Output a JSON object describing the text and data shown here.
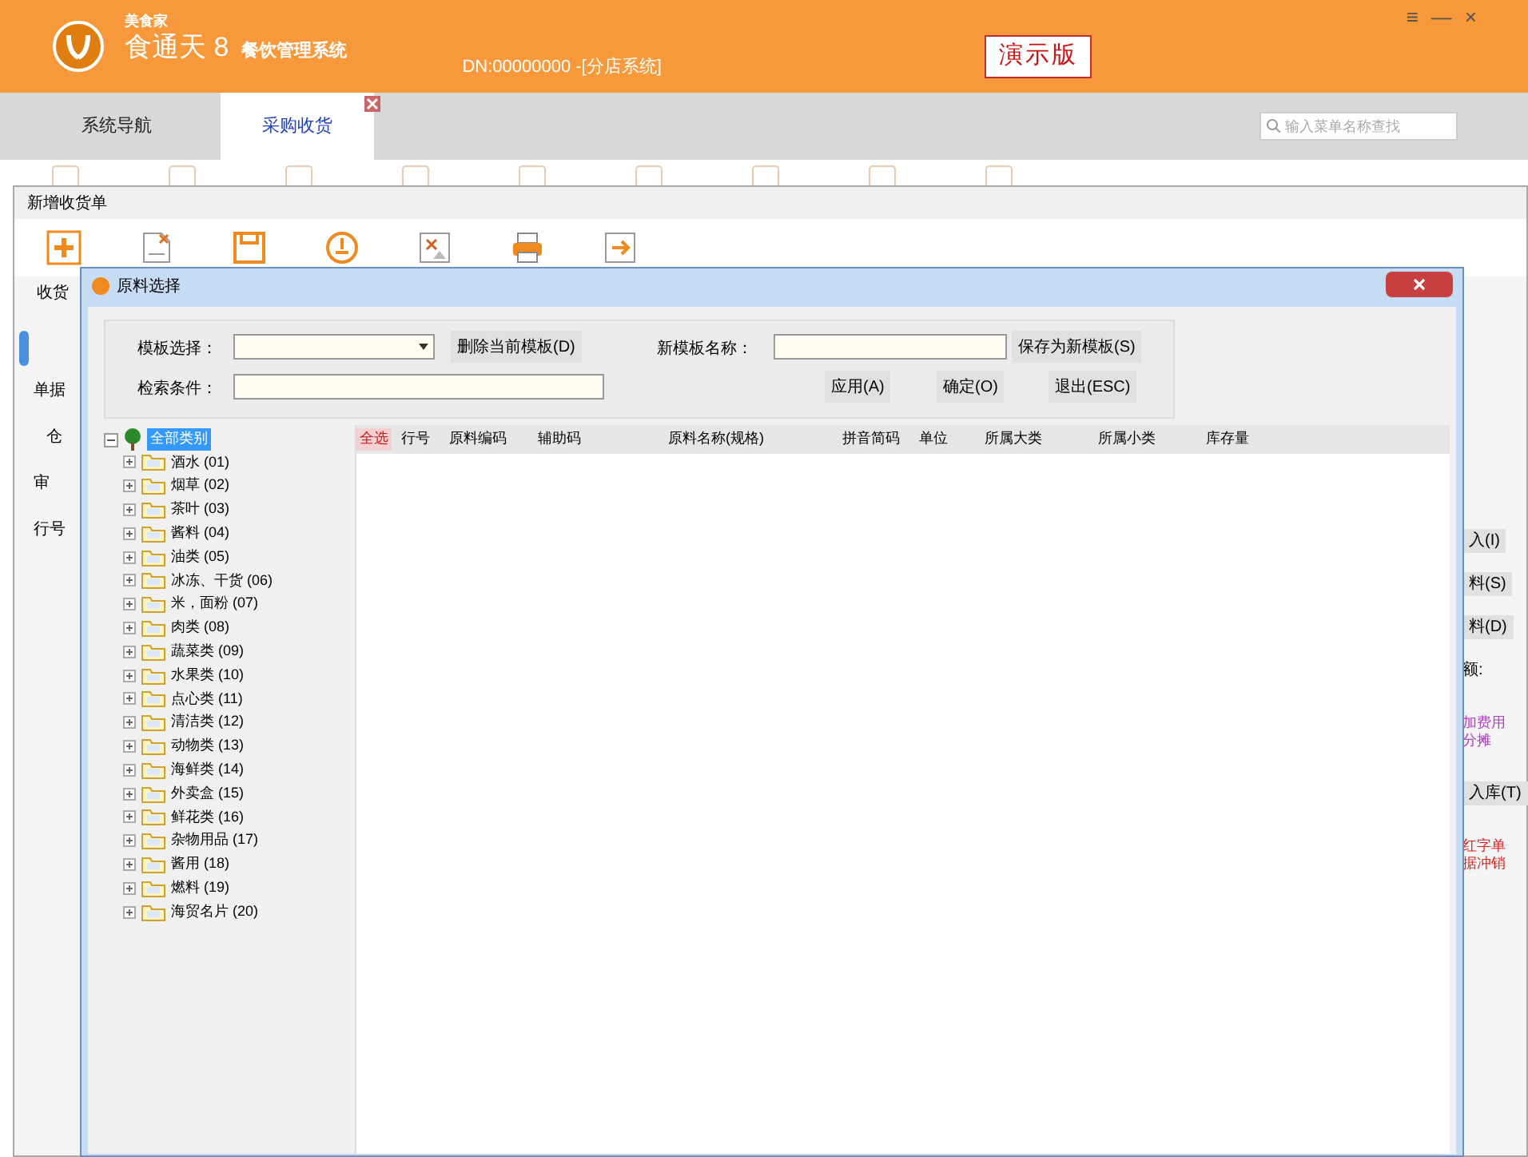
{
  "header": {
    "brand": "美食家",
    "product": "食通天 8",
    "subtitle": "餐饮管理系统",
    "device": "DN:00000000 -[分店系统]",
    "edition": "演示版",
    "controls": [
      "≡",
      "—",
      "×"
    ]
  },
  "tabs": [
    {
      "label": "系统导航",
      "selected": false,
      "closable": false
    },
    {
      "label": "采购收货",
      "selected": true,
      "closable": true
    }
  ],
  "search": {
    "placeholder": "输入菜单名称查找"
  },
  "form_window": {
    "title": "新增收货单",
    "toolbar": [
      {
        "kind": "add"
      },
      {
        "kind": "delete"
      },
      {
        "kind": "save"
      },
      {
        "kind": "stamp"
      },
      {
        "kind": "image"
      },
      {
        "kind": "print"
      },
      {
        "kind": "exit"
      }
    ],
    "section_label": "收货",
    "left_labels": [
      "单据",
      "仓",
      "审",
      "行号"
    ],
    "right_items": [
      {
        "kind": "button",
        "text": "入(I)"
      },
      {
        "kind": "button",
        "text": "料(S)"
      },
      {
        "kind": "button",
        "text": "料(D)"
      },
      {
        "kind": "label",
        "text": "额:"
      },
      {
        "kind": "note",
        "text": "加费用分摊",
        "color": "#b040c0"
      },
      {
        "kind": "button",
        "text": "入库(T)"
      },
      {
        "kind": "note",
        "text": "红字单据冲销",
        "color": "#e02020"
      }
    ]
  },
  "dialog": {
    "title": "原料选择",
    "template_label": "模板选择：",
    "delete_button": "删除当前模板(D)",
    "new_template_label": "新模板名称：",
    "save_button": "保存为新模板(S)",
    "filter_label": "检索条件：",
    "buttons": [
      "应用(A)",
      "确定(O)",
      "退出(ESC)"
    ],
    "tree": {
      "label": "全部类别",
      "selected": true,
      "expanded": true,
      "children": [
        {
          "label": "酒水 (01)",
          "selected": false
        },
        {
          "label": "烟草 (02)",
          "selected": false
        },
        {
          "label": "茶叶 (03)",
          "selected": false
        },
        {
          "label": "酱料 (04)",
          "selected": false
        },
        {
          "label": "油类 (05)",
          "selected": false
        },
        {
          "label": "冰冻、干货 (06)",
          "selected": false
        },
        {
          "label": "米，面粉 (07)",
          "selected": false
        },
        {
          "label": "肉类 (08)",
          "selected": false
        },
        {
          "label": "蔬菜类 (09)",
          "selected": false
        },
        {
          "label": "水果类 (10)",
          "selected": false
        },
        {
          "label": "点心类 (11)",
          "selected": false
        },
        {
          "label": "清洁类 (12)",
          "selected": false
        },
        {
          "label": "动物类 (13)",
          "selected": false
        },
        {
          "label": "海鲜类 (14)",
          "selected": false
        },
        {
          "label": "外卖盒 (15)",
          "selected": false
        },
        {
          "label": "鲜花类 (16)",
          "selected": false
        },
        {
          "label": "杂物用品 (17)",
          "selected": false
        },
        {
          "label": "酱用 (18)",
          "selected": false
        },
        {
          "label": "燃料 (19)",
          "selected": false
        },
        {
          "label": "海贸名片 (20)",
          "selected": false
        }
      ]
    },
    "select_all": "全选",
    "columns": [
      "行号",
      "原料编码",
      "辅助码",
      "原料名称(规格)",
      "拼音简码",
      "单位",
      "所属大类",
      "所属小类",
      "库存量"
    ]
  }
}
